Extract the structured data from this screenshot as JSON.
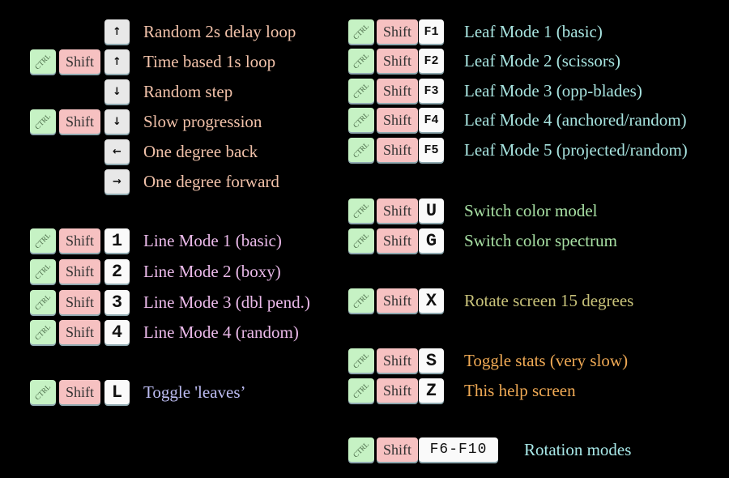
{
  "modifiers": {
    "ctrl": "CTRL",
    "shift": "Shift"
  },
  "left": [
    {
      "ctrl": false,
      "key": "↑",
      "key_icon": "arrow-up-icon",
      "label": "Random 2s delay loop",
      "color": "#f2c2aa"
    },
    {
      "ctrl": true,
      "key": "↑",
      "key_icon": "arrow-up-icon",
      "label": "Time based 1s loop",
      "color": "#f2c2aa"
    },
    {
      "ctrl": false,
      "key": "↓",
      "key_icon": "arrow-down-icon",
      "label": "Random step",
      "color": "#f2c2aa"
    },
    {
      "ctrl": true,
      "key": "↓",
      "key_icon": "arrow-down-icon",
      "label": "Slow progression",
      "color": "#f2c2aa"
    },
    {
      "ctrl": false,
      "key": "←",
      "key_icon": "arrow-left-icon",
      "label": "One degree back",
      "color": "#f2c2aa"
    },
    {
      "ctrl": false,
      "key": "→",
      "key_icon": "arrow-right-icon",
      "label": "One degree forward",
      "color": "#f2c2aa"
    },
    {
      "ctrl": true,
      "key": "1",
      "label": "Line Mode 1 (basic)",
      "color": "#ebbaea"
    },
    {
      "ctrl": true,
      "key": "2",
      "label": "Line Mode 2 (boxy)",
      "color": "#ebbaea"
    },
    {
      "ctrl": true,
      "key": "3",
      "label": "Line Mode 3 (dbl pend.)",
      "color": "#ebbaea"
    },
    {
      "ctrl": true,
      "key": "4",
      "label": "Line Mode 4 (random)",
      "color": "#ebbaea"
    },
    {
      "ctrl": true,
      "key": "L",
      "label": "Toggle 'leaves’",
      "color": "#bcbcf2"
    }
  ],
  "right": [
    {
      "ctrl": true,
      "key": "F1",
      "label": "Leaf Mode 1 (basic)",
      "color": "#a8e4e0"
    },
    {
      "ctrl": true,
      "key": "F2",
      "label": "Leaf Mode 2 (scissors)",
      "color": "#a8e4e0"
    },
    {
      "ctrl": true,
      "key": "F3",
      "label": "Leaf Mode 3 (opp-blades)",
      "color": "#a8e4e0"
    },
    {
      "ctrl": true,
      "key": "F4",
      "label": "Leaf Mode 4 (anchored/random)",
      "color": "#a8e4e0"
    },
    {
      "ctrl": true,
      "key": "F5",
      "label": "Leaf Mode 5 (projected/random)",
      "color": "#a8e4e0"
    },
    {
      "ctrl": true,
      "key": "U",
      "label": "Switch color model",
      "color": "#a8e0a4"
    },
    {
      "ctrl": true,
      "key": "G",
      "label": "Switch color spectrum",
      "color": "#a8e0a4"
    },
    {
      "ctrl": true,
      "key": "X",
      "label": "Rotate screen 15 degrees",
      "color": "#c8c27a"
    },
    {
      "ctrl": true,
      "key": "S",
      "label": "Toggle stats (very slow)",
      "color": "#f0aa55"
    },
    {
      "ctrl": true,
      "key": "Z",
      "label": "This help screen",
      "color": "#f0aa55"
    },
    {
      "ctrl": true,
      "key": "F6-F10",
      "label": "Rotation modes",
      "color": "#a8e8e8"
    }
  ]
}
